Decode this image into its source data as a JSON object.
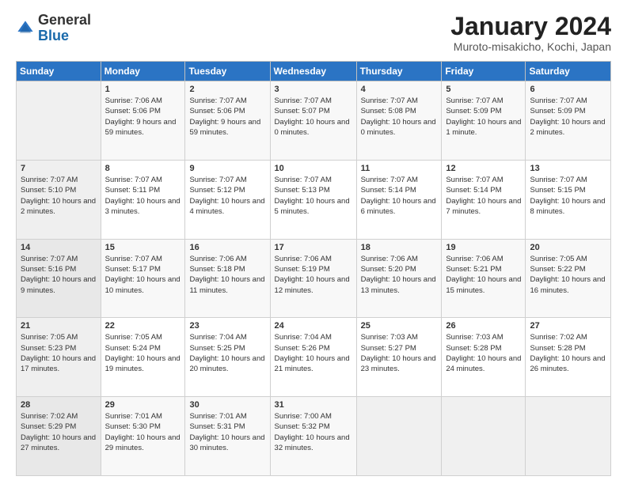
{
  "logo": {
    "general": "General",
    "blue": "Blue"
  },
  "header": {
    "title": "January 2024",
    "subtitle": "Muroto-misakicho, Kochi, Japan"
  },
  "weekdays": [
    "Sunday",
    "Monday",
    "Tuesday",
    "Wednesday",
    "Thursday",
    "Friday",
    "Saturday"
  ],
  "weeks": [
    [
      {
        "day": "",
        "sunrise": "",
        "sunset": "",
        "daylight": ""
      },
      {
        "day": "1",
        "sunrise": "Sunrise: 7:06 AM",
        "sunset": "Sunset: 5:06 PM",
        "daylight": "Daylight: 9 hours and 59 minutes."
      },
      {
        "day": "2",
        "sunrise": "Sunrise: 7:07 AM",
        "sunset": "Sunset: 5:06 PM",
        "daylight": "Daylight: 9 hours and 59 minutes."
      },
      {
        "day": "3",
        "sunrise": "Sunrise: 7:07 AM",
        "sunset": "Sunset: 5:07 PM",
        "daylight": "Daylight: 10 hours and 0 minutes."
      },
      {
        "day": "4",
        "sunrise": "Sunrise: 7:07 AM",
        "sunset": "Sunset: 5:08 PM",
        "daylight": "Daylight: 10 hours and 0 minutes."
      },
      {
        "day": "5",
        "sunrise": "Sunrise: 7:07 AM",
        "sunset": "Sunset: 5:09 PM",
        "daylight": "Daylight: 10 hours and 1 minute."
      },
      {
        "day": "6",
        "sunrise": "Sunrise: 7:07 AM",
        "sunset": "Sunset: 5:09 PM",
        "daylight": "Daylight: 10 hours and 2 minutes."
      }
    ],
    [
      {
        "day": "7",
        "sunrise": "Sunrise: 7:07 AM",
        "sunset": "Sunset: 5:10 PM",
        "daylight": "Daylight: 10 hours and 2 minutes."
      },
      {
        "day": "8",
        "sunrise": "Sunrise: 7:07 AM",
        "sunset": "Sunset: 5:11 PM",
        "daylight": "Daylight: 10 hours and 3 minutes."
      },
      {
        "day": "9",
        "sunrise": "Sunrise: 7:07 AM",
        "sunset": "Sunset: 5:12 PM",
        "daylight": "Daylight: 10 hours and 4 minutes."
      },
      {
        "day": "10",
        "sunrise": "Sunrise: 7:07 AM",
        "sunset": "Sunset: 5:13 PM",
        "daylight": "Daylight: 10 hours and 5 minutes."
      },
      {
        "day": "11",
        "sunrise": "Sunrise: 7:07 AM",
        "sunset": "Sunset: 5:14 PM",
        "daylight": "Daylight: 10 hours and 6 minutes."
      },
      {
        "day": "12",
        "sunrise": "Sunrise: 7:07 AM",
        "sunset": "Sunset: 5:14 PM",
        "daylight": "Daylight: 10 hours and 7 minutes."
      },
      {
        "day": "13",
        "sunrise": "Sunrise: 7:07 AM",
        "sunset": "Sunset: 5:15 PM",
        "daylight": "Daylight: 10 hours and 8 minutes."
      }
    ],
    [
      {
        "day": "14",
        "sunrise": "Sunrise: 7:07 AM",
        "sunset": "Sunset: 5:16 PM",
        "daylight": "Daylight: 10 hours and 9 minutes."
      },
      {
        "day": "15",
        "sunrise": "Sunrise: 7:07 AM",
        "sunset": "Sunset: 5:17 PM",
        "daylight": "Daylight: 10 hours and 10 minutes."
      },
      {
        "day": "16",
        "sunrise": "Sunrise: 7:06 AM",
        "sunset": "Sunset: 5:18 PM",
        "daylight": "Daylight: 10 hours and 11 minutes."
      },
      {
        "day": "17",
        "sunrise": "Sunrise: 7:06 AM",
        "sunset": "Sunset: 5:19 PM",
        "daylight": "Daylight: 10 hours and 12 minutes."
      },
      {
        "day": "18",
        "sunrise": "Sunrise: 7:06 AM",
        "sunset": "Sunset: 5:20 PM",
        "daylight": "Daylight: 10 hours and 13 minutes."
      },
      {
        "day": "19",
        "sunrise": "Sunrise: 7:06 AM",
        "sunset": "Sunset: 5:21 PM",
        "daylight": "Daylight: 10 hours and 15 minutes."
      },
      {
        "day": "20",
        "sunrise": "Sunrise: 7:05 AM",
        "sunset": "Sunset: 5:22 PM",
        "daylight": "Daylight: 10 hours and 16 minutes."
      }
    ],
    [
      {
        "day": "21",
        "sunrise": "Sunrise: 7:05 AM",
        "sunset": "Sunset: 5:23 PM",
        "daylight": "Daylight: 10 hours and 17 minutes."
      },
      {
        "day": "22",
        "sunrise": "Sunrise: 7:05 AM",
        "sunset": "Sunset: 5:24 PM",
        "daylight": "Daylight: 10 hours and 19 minutes."
      },
      {
        "day": "23",
        "sunrise": "Sunrise: 7:04 AM",
        "sunset": "Sunset: 5:25 PM",
        "daylight": "Daylight: 10 hours and 20 minutes."
      },
      {
        "day": "24",
        "sunrise": "Sunrise: 7:04 AM",
        "sunset": "Sunset: 5:26 PM",
        "daylight": "Daylight: 10 hours and 21 minutes."
      },
      {
        "day": "25",
        "sunrise": "Sunrise: 7:03 AM",
        "sunset": "Sunset: 5:27 PM",
        "daylight": "Daylight: 10 hours and 23 minutes."
      },
      {
        "day": "26",
        "sunrise": "Sunrise: 7:03 AM",
        "sunset": "Sunset: 5:28 PM",
        "daylight": "Daylight: 10 hours and 24 minutes."
      },
      {
        "day": "27",
        "sunrise": "Sunrise: 7:02 AM",
        "sunset": "Sunset: 5:28 PM",
        "daylight": "Daylight: 10 hours and 26 minutes."
      }
    ],
    [
      {
        "day": "28",
        "sunrise": "Sunrise: 7:02 AM",
        "sunset": "Sunset: 5:29 PM",
        "daylight": "Daylight: 10 hours and 27 minutes."
      },
      {
        "day": "29",
        "sunrise": "Sunrise: 7:01 AM",
        "sunset": "Sunset: 5:30 PM",
        "daylight": "Daylight: 10 hours and 29 minutes."
      },
      {
        "day": "30",
        "sunrise": "Sunrise: 7:01 AM",
        "sunset": "Sunset: 5:31 PM",
        "daylight": "Daylight: 10 hours and 30 minutes."
      },
      {
        "day": "31",
        "sunrise": "Sunrise: 7:00 AM",
        "sunset": "Sunset: 5:32 PM",
        "daylight": "Daylight: 10 hours and 32 minutes."
      },
      {
        "day": "",
        "sunrise": "",
        "sunset": "",
        "daylight": ""
      },
      {
        "day": "",
        "sunrise": "",
        "sunset": "",
        "daylight": ""
      },
      {
        "day": "",
        "sunrise": "",
        "sunset": "",
        "daylight": ""
      }
    ]
  ]
}
